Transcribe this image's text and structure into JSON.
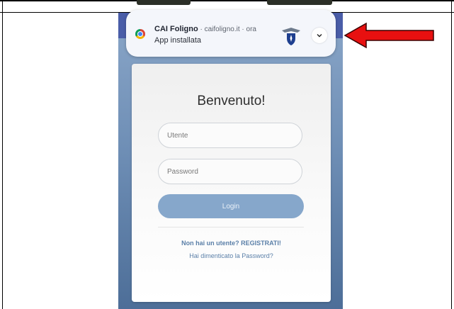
{
  "notification": {
    "app_name": "CAI Foligno",
    "meta": " · caifoligno.it · ora",
    "message": "App installata",
    "browser_icon": "chrome-icon",
    "logo_icon": "cai-logo-icon",
    "expand_icon": "chevron-down-icon"
  },
  "login": {
    "title": "Benvenuto!",
    "username_placeholder": "Utente",
    "password_placeholder": "Password",
    "login_button": "Login",
    "register_link": "Non hai un utente? REGISTRATI!",
    "forgot_link": "Hai dimenticato la Password?"
  },
  "colors": {
    "annotation_arrow": "#e81010",
    "accent": "#86a7cb",
    "link": "#5a7fa8"
  }
}
